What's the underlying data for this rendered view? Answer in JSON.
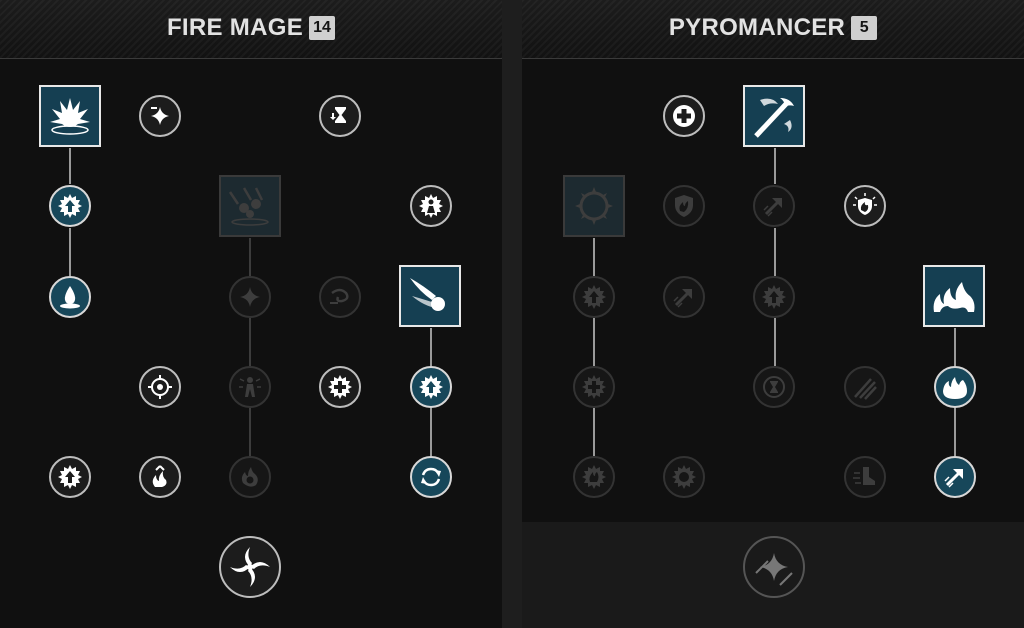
{
  "left_tree": {
    "title": "FIRE MAGE",
    "level": "14"
  },
  "right_tree": {
    "title": "PYROMANCER",
    "level": "5"
  },
  "colors": {
    "active_node": "#17475a",
    "active_border": "#d8d8d8",
    "panel_bg": "#101010",
    "locked_border": "#333333"
  },
  "left_nodes": [
    {
      "icon": "fire-burst-icon",
      "state": "active"
    },
    {
      "icon": "shine-minus-icon",
      "state": "available"
    },
    {
      "icon": "hourglass-icon",
      "state": "available"
    },
    {
      "icon": "up-arrow-star-icon",
      "state": "active"
    },
    {
      "icon": "meteor-shower-icon",
      "state": "locked"
    },
    {
      "icon": "figure-star-icon",
      "state": "available"
    },
    {
      "icon": "flame-drop-icon",
      "state": "active"
    },
    {
      "icon": "shine-icon",
      "state": "locked"
    },
    {
      "icon": "swirl-icon",
      "state": "locked"
    },
    {
      "icon": "fireball-icon",
      "state": "active"
    },
    {
      "icon": "crosshair-icon",
      "state": "available"
    },
    {
      "icon": "figure-icon",
      "state": "locked"
    },
    {
      "icon": "plus-star-icon",
      "state": "available"
    },
    {
      "icon": "up-arrow-star-icon",
      "state": "active"
    },
    {
      "icon": "up-arrow-star-icon",
      "state": "available"
    },
    {
      "icon": "flame-up-icon",
      "state": "available"
    },
    {
      "icon": "skull-flame-icon",
      "state": "locked"
    },
    {
      "icon": "cycle-arrows-icon",
      "state": "active"
    },
    {
      "icon": "ultimate-swirl-icon",
      "state": "available"
    }
  ],
  "right_nodes": [
    {
      "icon": "medic-cross-icon",
      "state": "available"
    },
    {
      "icon": "flame-sword-icon",
      "state": "active"
    },
    {
      "icon": "ring-of-fire-icon",
      "state": "locked"
    },
    {
      "icon": "shield-flame-icon",
      "state": "locked"
    },
    {
      "icon": "arrow-up-right-icon",
      "state": "locked"
    },
    {
      "icon": "shield-burst-icon",
      "state": "available"
    },
    {
      "icon": "up-arrow-star-icon",
      "state": "locked"
    },
    {
      "icon": "arrow-up-right-icon",
      "state": "locked"
    },
    {
      "icon": "up-arrow-star-icon",
      "state": "locked"
    },
    {
      "icon": "fire-wave-icon",
      "state": "active"
    },
    {
      "icon": "plus-star-icon",
      "state": "locked"
    },
    {
      "icon": "hourglass-icon",
      "state": "locked"
    },
    {
      "icon": "claw-slash-icon",
      "state": "locked"
    },
    {
      "icon": "flames-icon",
      "state": "active"
    },
    {
      "icon": "flame-badge-icon",
      "state": "locked"
    },
    {
      "icon": "burst-ring-icon",
      "state": "locked"
    },
    {
      "icon": "boot-dash-icon",
      "state": "locked"
    },
    {
      "icon": "arrow-up-right-icon",
      "state": "active"
    },
    {
      "icon": "ultimate-shine-icon",
      "state": "dim"
    }
  ]
}
